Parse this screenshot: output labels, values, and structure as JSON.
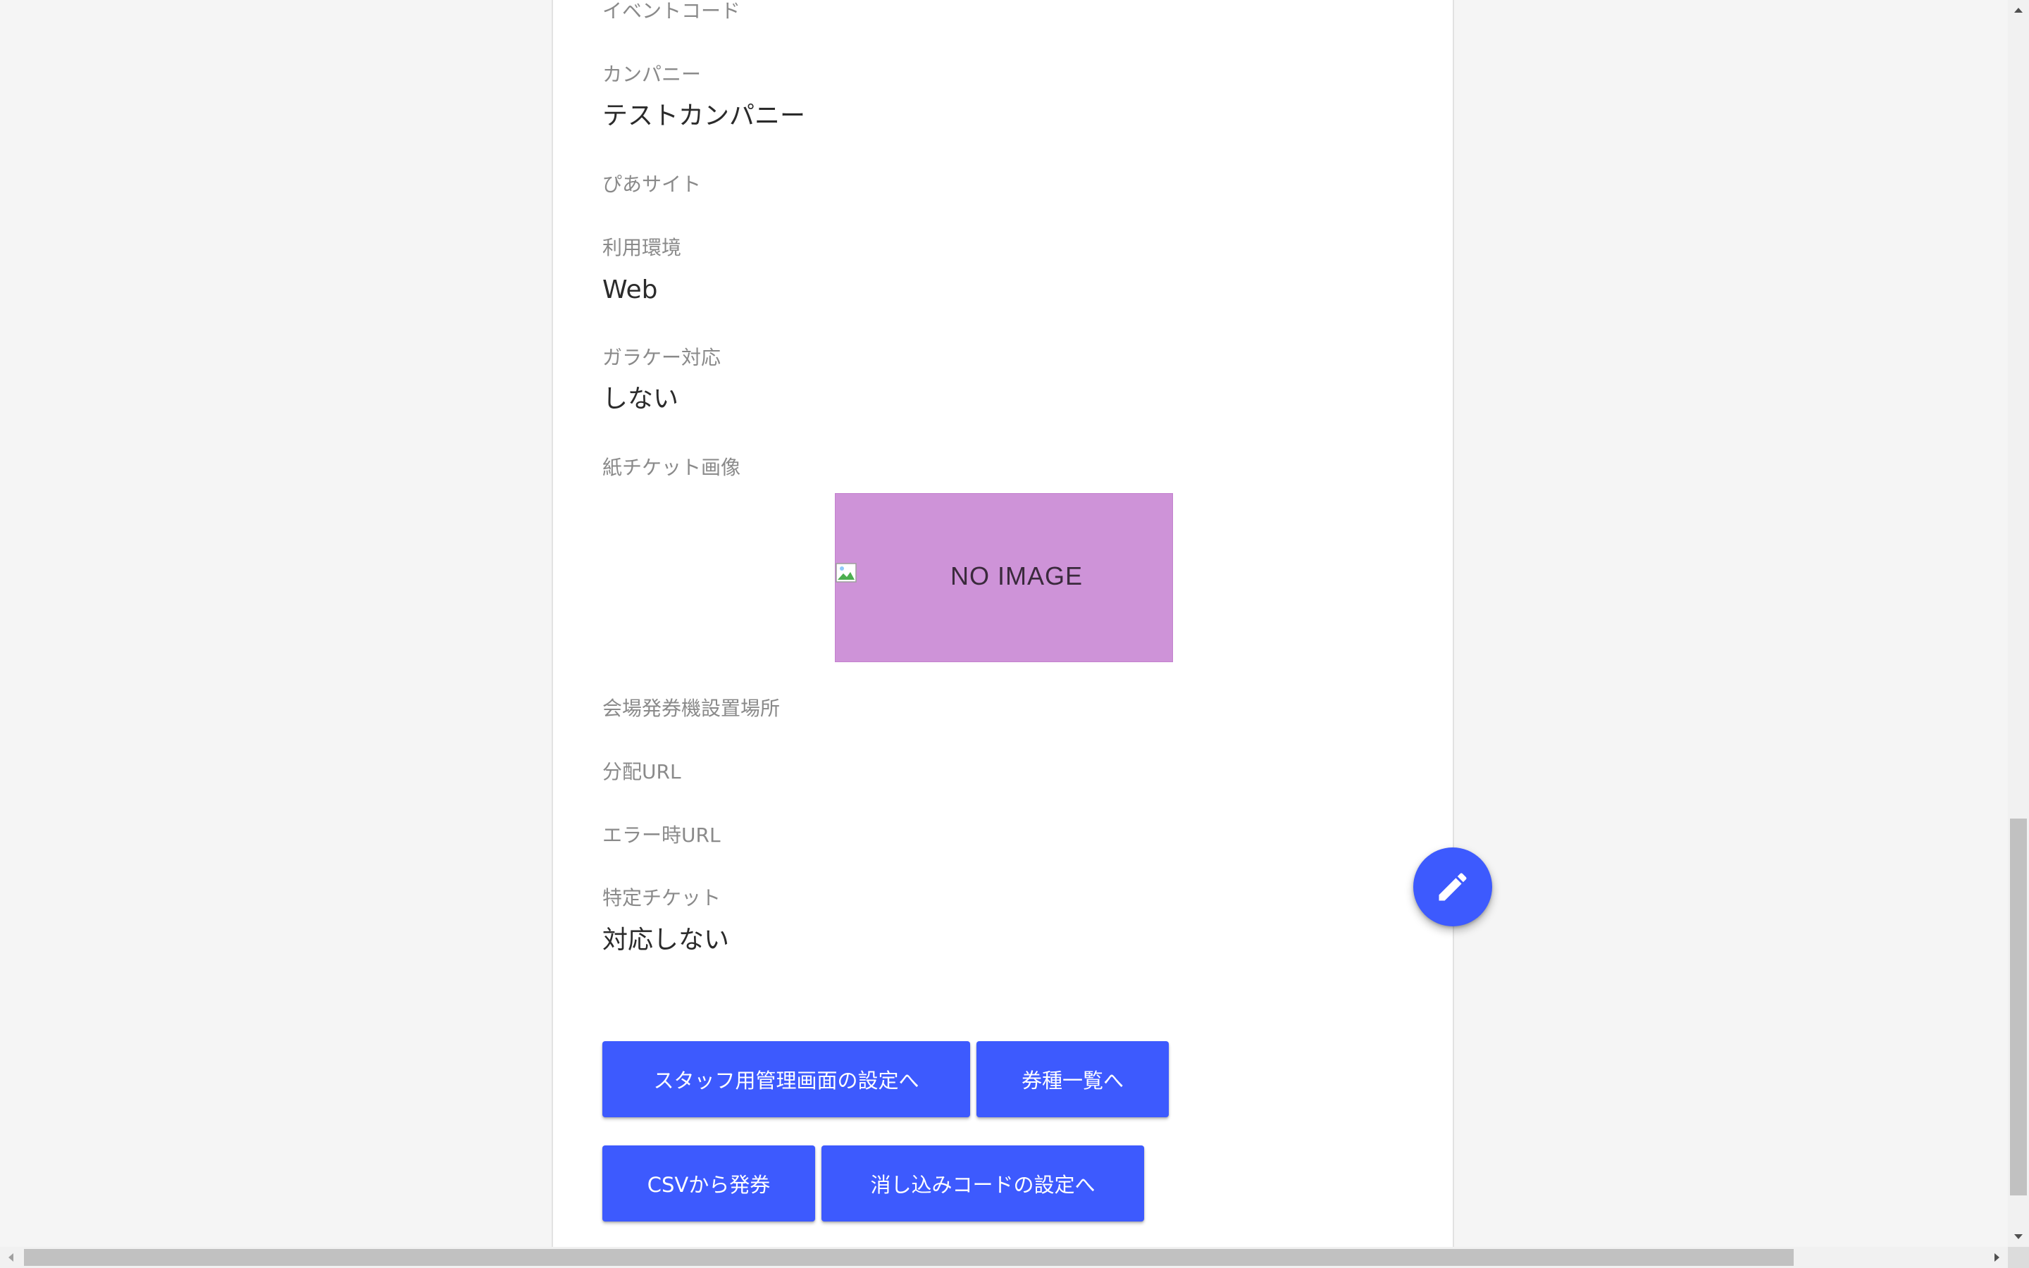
{
  "fields": [
    {
      "label": "イベントコード",
      "value": ""
    },
    {
      "label": "カンパニー",
      "value": "テストカンパニー"
    },
    {
      "label": "ぴあサイト",
      "value": ""
    },
    {
      "label": "利用環境",
      "value": "Web"
    },
    {
      "label": "ガラケー対応",
      "value": "しない"
    },
    {
      "label": "紙チケット画像",
      "value": ""
    },
    {
      "label": "会場発券機設置場所",
      "value": ""
    },
    {
      "label": "分配URL",
      "value": ""
    },
    {
      "label": "エラー時URL",
      "value": ""
    },
    {
      "label": "特定チケット",
      "value": "対応しない"
    }
  ],
  "paper_ticket_image": {
    "placeholder_text": "NO IMAGE",
    "background_color": "#ce93d8"
  },
  "buttons": {
    "staff_admin_settings": "スタッフ用管理画面の設定へ",
    "ticket_type_list": "券種一覧へ",
    "issue_from_csv": "CSVから発券",
    "redemption_code_settings": "消し込みコードの設定へ"
  },
  "fab": {
    "icon": "pencil-icon"
  },
  "colors": {
    "primary": "#3d5afe",
    "label_text": "#8a8a8a",
    "value_text": "#2b2b2b",
    "page_background": "#f5f5f5",
    "card_background": "#ffffff"
  }
}
